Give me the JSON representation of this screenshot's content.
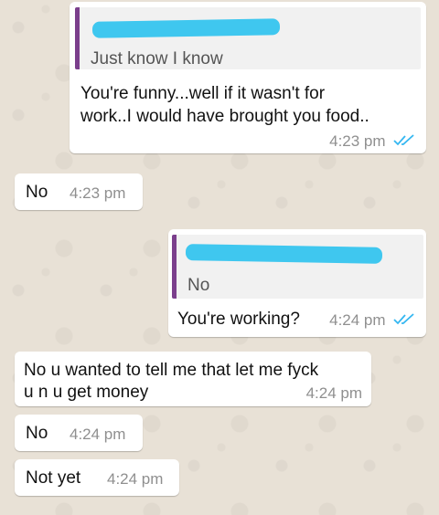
{
  "messages": [
    {
      "direction": "outgoing",
      "quoted_text": "Just know I know",
      "text_lines": [
        "You're funny...well if it wasn't for",
        "work..I would have brought you food.."
      ],
      "time": "4:23 pm",
      "status": "read"
    },
    {
      "direction": "incoming",
      "text": "No",
      "time": "4:23 pm"
    },
    {
      "direction": "outgoing",
      "quoted_text": "No",
      "text": "You're working?",
      "time": "4:24 pm",
      "status": "read"
    },
    {
      "direction": "incoming",
      "text_lines": [
        "No u wanted to tell me that let me fyck",
        "u n u get money"
      ],
      "time": "4:24 pm"
    },
    {
      "direction": "incoming",
      "text": "No",
      "time": "4:24 pm"
    },
    {
      "direction": "incoming",
      "text": "Not yet",
      "time": "4:24 pm"
    }
  ],
  "colors": {
    "wallpaper": "#e8e1d6",
    "bubble": "#ffffff",
    "quote_bar": "#7b3f8c",
    "redaction": "#3fc7ef",
    "read_ticks": "#34b7f1"
  },
  "icons": {
    "read_receipt": "double-check-icon"
  }
}
